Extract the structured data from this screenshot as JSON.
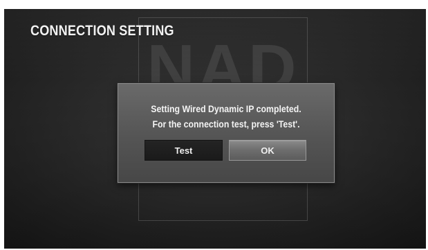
{
  "screen": {
    "title": "CONNECTION SETTING",
    "background_logo": "NAD"
  },
  "dialog": {
    "message_line1": "Setting Wired Dynamic IP completed.",
    "message_line2": "For the connection test, press 'Test'.",
    "buttons": {
      "test_label": "Test",
      "ok_label": "OK",
      "focused": "OK"
    }
  },
  "colors": {
    "background": "#2b2b2b",
    "dialog": "#565656",
    "button_normal": "#1f1f1f",
    "button_focused": "#7a7a7a",
    "text": "#f2f2f2"
  }
}
